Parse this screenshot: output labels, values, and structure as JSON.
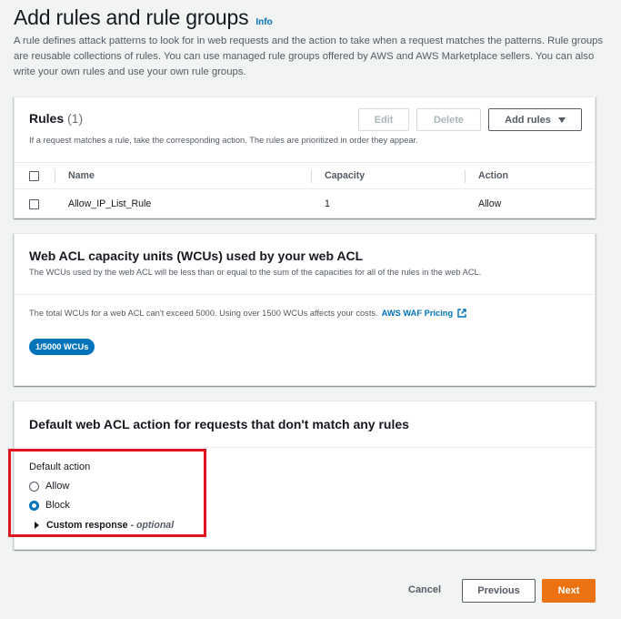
{
  "header": {
    "title": "Add rules and rule groups",
    "info_link": "Info",
    "description": "A rule defines attack patterns to look for in web requests and the action to take when a request matches the patterns. Rule groups are reusable collections of rules. You can use managed rule groups offered by AWS and AWS Marketplace sellers. You can also write your own rules and use your own rule groups."
  },
  "rules_panel": {
    "title": "Rules",
    "count": "(1)",
    "subtitle": "If a request matches a rule, take the corresponding action. The rules are prioritized in order they appear.",
    "edit_label": "Edit",
    "delete_label": "Delete",
    "add_rules_label": "Add rules",
    "columns": {
      "name": "Name",
      "capacity": "Capacity",
      "action": "Action"
    },
    "rows": [
      {
        "name": "Allow_IP_List_Rule",
        "capacity": "1",
        "action": "Allow"
      }
    ]
  },
  "wcu_panel": {
    "title": "Web ACL capacity units (WCUs) used by your web ACL",
    "subtitle": "The WCUs used by the web ACL will be less than or equal to the sum of the capacities for all of the rules in the web ACL.",
    "note": "The total WCUs for a web ACL can't exceed 5000. Using over 1500 WCUs affects your costs.",
    "pricing_link": "AWS WAF Pricing",
    "badge": "1/5000 WCUs"
  },
  "default_panel": {
    "title": "Default web ACL action for requests that don't match any rules",
    "label": "Default action",
    "options": [
      {
        "label": "Allow",
        "selected": false
      },
      {
        "label": "Block",
        "selected": true
      }
    ],
    "custom_response": "Custom response",
    "optional": "- optional"
  },
  "footer": {
    "cancel_label": "Cancel",
    "previous_label": "Previous",
    "next_label": "Next"
  },
  "colors": {
    "primary_orange": "#ec7211",
    "link_blue": "#0073bb",
    "highlight_red": "#e0141e"
  }
}
